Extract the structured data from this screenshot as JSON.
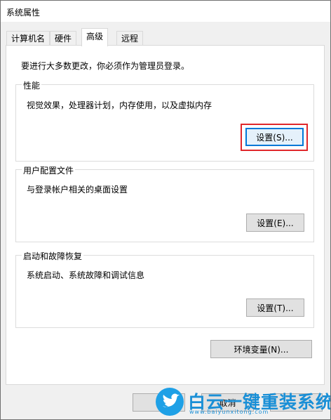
{
  "window": {
    "title": "系统属性"
  },
  "tabs": [
    {
      "label": "计算机名"
    },
    {
      "label": "硬件"
    },
    {
      "label": "高级"
    },
    {
      "label": "远程"
    }
  ],
  "advanced": {
    "admin_note": "要进行大多数更改，你必须作为管理员登录。",
    "performance": {
      "title": "性能",
      "desc": "视觉效果，处理器计划，内存使用，以及虚拟内存",
      "button": "设置(S)..."
    },
    "user_profiles": {
      "title": "用户配置文件",
      "desc": "与登录帐户相关的桌面设置",
      "button": "设置(E)..."
    },
    "startup_recovery": {
      "title": "启动和故障恢复",
      "desc": "系统启动、系统故障和调试信息",
      "button": "设置(T)..."
    },
    "env_button": "环境变量(N)..."
  },
  "footer": {
    "cancel": "取消"
  },
  "watermark": {
    "main": "白云一键重装系统",
    "url": "www.baiyunxitong.com"
  },
  "colors": {
    "focus_border": "#0078d7",
    "highlight_box": "#e0272b",
    "watermark_blue": "#1a8fd6"
  }
}
